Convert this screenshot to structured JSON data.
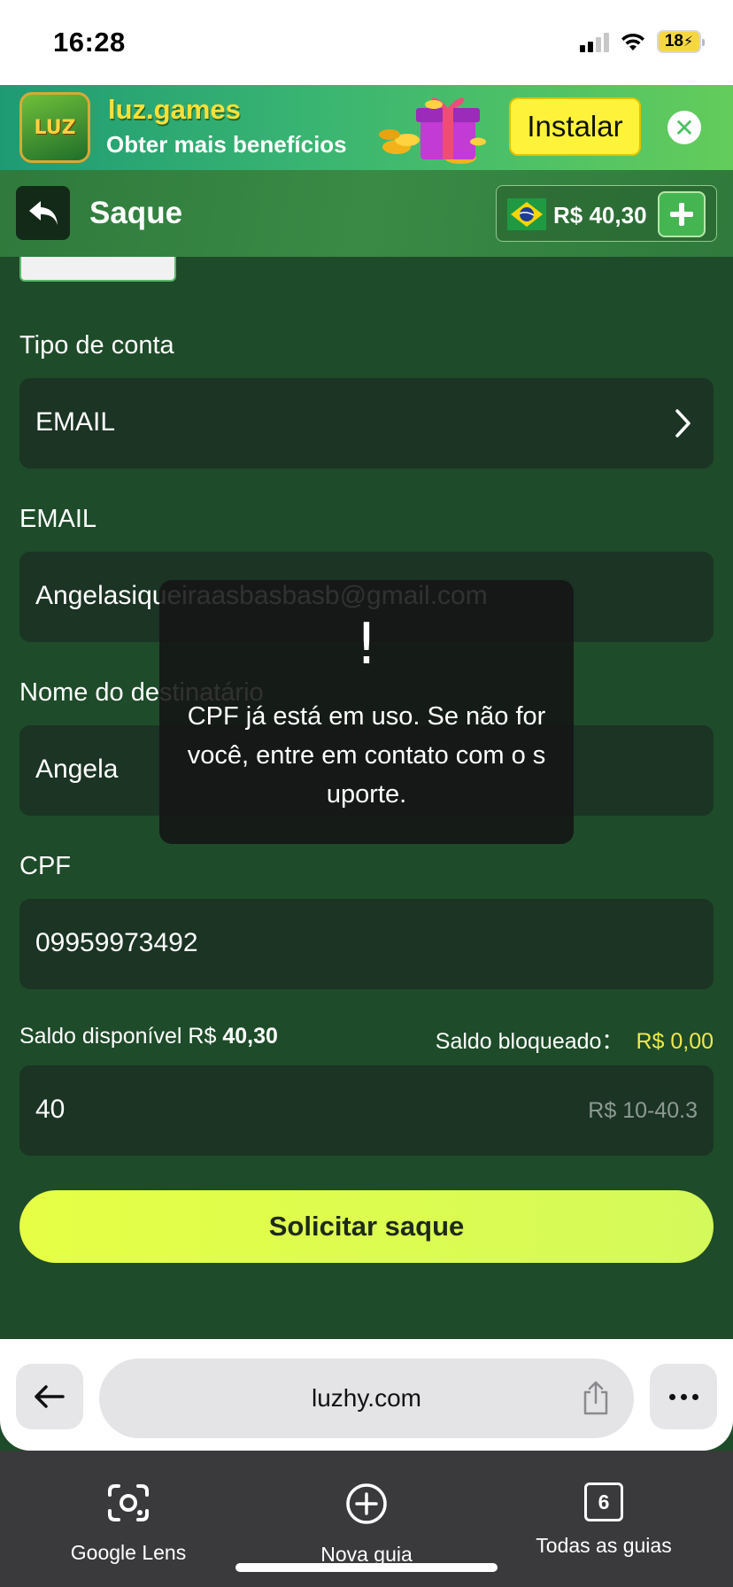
{
  "status_bar": {
    "time": "16:28",
    "battery": "18"
  },
  "promo": {
    "logo_text": "LUZ",
    "title": "luz.games",
    "subtitle": "Obter mais benefícios",
    "install_label": "Instalar",
    "close_glyph": "✕"
  },
  "header": {
    "title": "Saque",
    "balance": "R$ 40,30",
    "accent_color": "#45b551"
  },
  "form": {
    "account_type": {
      "label": "Tipo de conta",
      "value": "EMAIL"
    },
    "email": {
      "label": "EMAIL",
      "value": "Angelasiqueiraasbasbasb@gmail.com"
    },
    "recipient": {
      "label": "Nome do destinatário",
      "value": "Angela"
    },
    "cpf": {
      "label": "CPF",
      "value": "09959973492"
    },
    "saldo_disponivel_label": "Saldo disponível R$",
    "saldo_disponivel_value": "40,30",
    "saldo_bloqueado_label": "Saldo bloqueado：",
    "saldo_bloqueado_value": "R$ 0,00",
    "amount": {
      "value": "40",
      "hint": "R$ 10-40.3"
    },
    "submit_label": "Solicitar saque"
  },
  "toast": {
    "icon": "!",
    "message": "CPF já está em uso. Se não for você, entre em contato com o suporte."
  },
  "browser": {
    "url": "luzhy.com",
    "tabs_count": "6",
    "google_lens": "Google Lens",
    "new_tab": "Nova guia",
    "all_tabs": "Todas as guias"
  }
}
